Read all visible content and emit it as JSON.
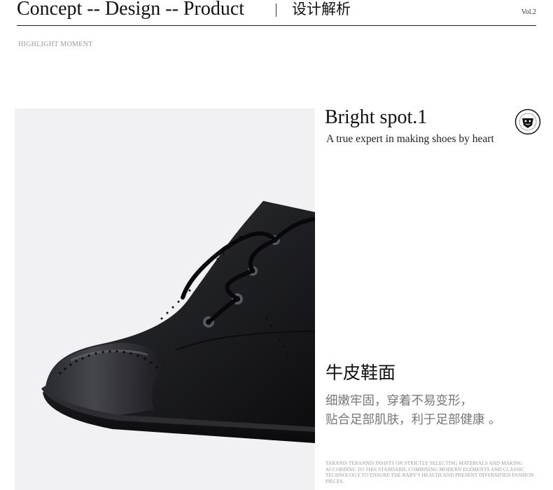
{
  "header": {
    "title": "Concept -- Design -- Product",
    "title_cn": "设计解析",
    "volume": "Vol.2"
  },
  "section_label": "HIGHLIGHT MOMENT",
  "product_image": {
    "subject": "black leather lace-up brogue boot",
    "background_color": "#f1f1f3"
  },
  "spot": {
    "title": "Bright spot.1",
    "subtitle": "A true expert in making shoes by heart",
    "badge_icon": "lion-emblem-icon"
  },
  "feature": {
    "title": "牛皮鞋面",
    "description_line1": "细嫩牢固，穿着不易变形，",
    "description_line2": "贴合足部肌肤，利于足部健康 。"
  },
  "fine_print": "TARANIS TERANNIS INSISTS ON STRICTLY SELECTING MATERIALS AND MAKING ACCORDING TO THIS STANDARD, COMBINING MODERN ELEMENTS AND CLASSIC TECHNOLOGY TO ENSURE THE BABY'S HEALTH AND PRESENT DIVERSIFIED FASHION PIECES."
}
